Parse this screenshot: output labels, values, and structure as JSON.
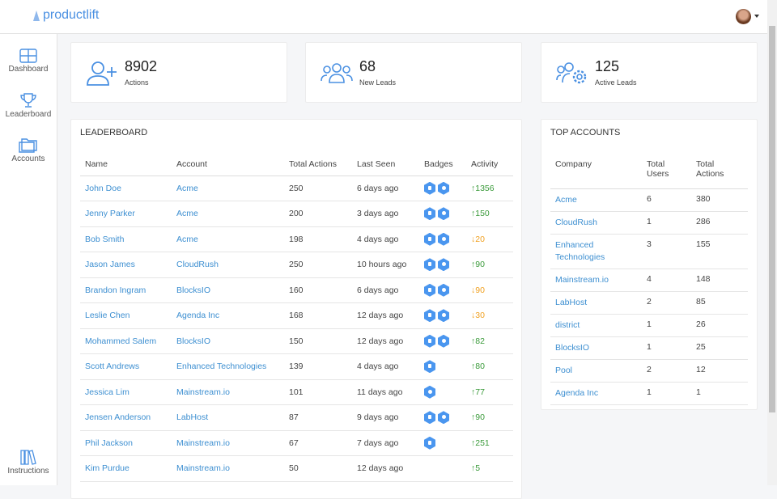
{
  "app": {
    "name": "productlift"
  },
  "sidebar": {
    "items": [
      {
        "label": "Dashboard",
        "icon": "grid-icon"
      },
      {
        "label": "Leaderboard",
        "icon": "trophy-icon"
      },
      {
        "label": "Accounts",
        "icon": "folder-icon"
      },
      {
        "label": "Instructions",
        "icon": "books-icon"
      }
    ]
  },
  "stats": [
    {
      "value": "8902",
      "label": "Actions"
    },
    {
      "value": "68",
      "label": "New Leads"
    },
    {
      "value": "125",
      "label": "Active Leads"
    }
  ],
  "leaderboard": {
    "title": "LEADERBOARD",
    "columns": [
      "Name",
      "Account",
      "Total Actions",
      "Last Seen",
      "Badges",
      "Activity"
    ],
    "rows": [
      {
        "name": "John Doe",
        "account": "Acme",
        "actions": "250",
        "seen": "6 days ago",
        "badges": [
          "document",
          "award"
        ],
        "dir": "up",
        "activity": "1356"
      },
      {
        "name": "Jenny Parker",
        "account": "Acme",
        "actions": "200",
        "seen": "3 days ago",
        "badges": [
          "document",
          "award"
        ],
        "dir": "up",
        "activity": "150"
      },
      {
        "name": "Bob Smith",
        "account": "Acme",
        "actions": "198",
        "seen": "4 days ago",
        "badges": [
          "document",
          "award"
        ],
        "dir": "down",
        "activity": "20"
      },
      {
        "name": "Jason James",
        "account": "CloudRush",
        "actions": "250",
        "seen": "10 hours ago",
        "badges": [
          "document",
          "award"
        ],
        "dir": "up",
        "activity": "90"
      },
      {
        "name": "Brandon Ingram",
        "account": "BlocksIO",
        "actions": "160",
        "seen": "6 days ago",
        "badges": [
          "document",
          "award"
        ],
        "dir": "down",
        "activity": "90"
      },
      {
        "name": "Leslie Chen",
        "account": "Agenda Inc",
        "actions": "168",
        "seen": "12 days ago",
        "badges": [
          "document",
          "award"
        ],
        "dir": "down",
        "activity": "30"
      },
      {
        "name": "Mohammed Salem",
        "account": "BlocksIO",
        "actions": "150",
        "seen": "12 days ago",
        "badges": [
          "document",
          "award"
        ],
        "dir": "up",
        "activity": "82"
      },
      {
        "name": "Scott Andrews",
        "account": "Enhanced Technologies",
        "actions": "139",
        "seen": "4 days ago",
        "badges": [
          "document"
        ],
        "dir": "up",
        "activity": "80"
      },
      {
        "name": "Jessica Lim",
        "account": "Mainstream.io",
        "actions": "101",
        "seen": "11 days ago",
        "badges": [
          "award"
        ],
        "dir": "up",
        "activity": "77"
      },
      {
        "name": "Jensen Anderson",
        "account": "LabHost",
        "actions": "87",
        "seen": "9 days ago",
        "badges": [
          "document",
          "award"
        ],
        "dir": "up",
        "activity": "90"
      },
      {
        "name": "Phil Jackson",
        "account": "Mainstream.io",
        "actions": "67",
        "seen": "7 days ago",
        "badges": [
          "document"
        ],
        "dir": "up",
        "activity": "251"
      },
      {
        "name": "Kim Purdue",
        "account": "Mainstream.io",
        "actions": "50",
        "seen": "12 days ago",
        "badges": [],
        "dir": "up",
        "activity": "5"
      }
    ]
  },
  "top_accounts": {
    "title": "TOP ACCOUNTS",
    "columns": [
      "Company",
      "Total Users",
      "Total Actions"
    ],
    "rows": [
      {
        "company": "Acme",
        "users": "6",
        "actions": "380"
      },
      {
        "company": "CloudRush",
        "users": "1",
        "actions": "286"
      },
      {
        "company": "Enhanced Technologies",
        "users": "3",
        "actions": "155"
      },
      {
        "company": "Mainstream.io",
        "users": "4",
        "actions": "148"
      },
      {
        "company": "LabHost",
        "users": "2",
        "actions": "85"
      },
      {
        "company": "district",
        "users": "1",
        "actions": "26"
      },
      {
        "company": "BlocksIO",
        "users": "1",
        "actions": "25"
      },
      {
        "company": "Pool",
        "users": "2",
        "actions": "12"
      },
      {
        "company": "Agenda Inc",
        "users": "1",
        "actions": "1"
      }
    ]
  },
  "colors": {
    "accent": "#4a90e2",
    "up": "#3a9a3a",
    "down": "#f0a020"
  }
}
